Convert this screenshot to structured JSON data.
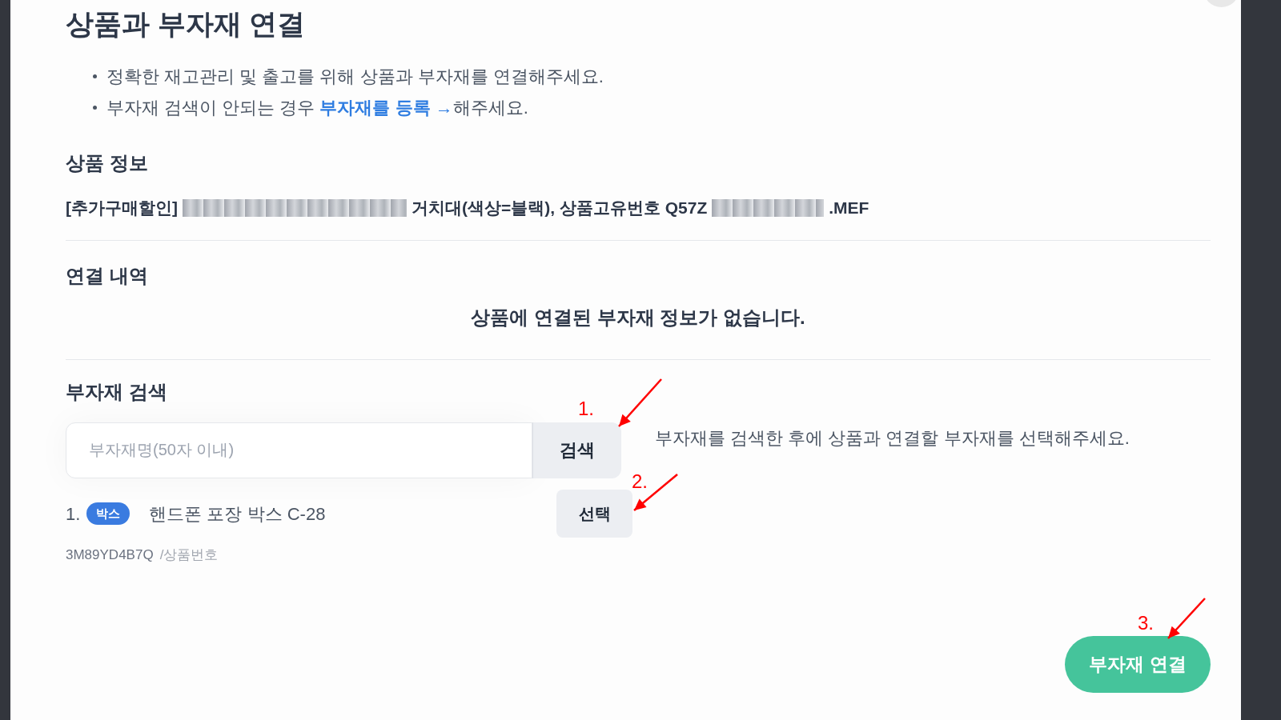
{
  "modal": {
    "title": "상품과 부자재 연결",
    "notes": [
      {
        "text": "정확한 재고관리 및 출고를 위해 상품과 부자재를 연결해주세요."
      },
      {
        "text": "부자재 검색이 안되는 경우 ",
        "link": "부자재를 등록 →",
        "after": "해주세요."
      }
    ],
    "product_info": {
      "heading": "상품 정보",
      "segments": [
        {
          "kind": "text",
          "text": "[추가구매할인]"
        },
        {
          "kind": "redacted"
        },
        {
          "kind": "text",
          "text": "거치대(색상=블랙), 상품고유번호 Q57Z"
        },
        {
          "kind": "redacted"
        },
        {
          "kind": "text",
          "text": ".MEF"
        }
      ]
    },
    "links": {
      "heading": "연결 내역",
      "empty_message": "상품에 연결된 부자재 정보가 없습니다."
    },
    "search": {
      "heading": "부자재 검색",
      "placeholder": "부자재명(50자 이내)",
      "button": "검색",
      "hint": "부자재를 검색한 후에 상품과 연결할 부자재를 선택해주세요.",
      "results": [
        {
          "index": "1.",
          "tag": "박스",
          "name": "핸드폰 포장 박스 C-28",
          "code": "3M89YD4B7Q",
          "code_label": "/상품번호",
          "button": "선택"
        }
      ]
    },
    "submit_button": "부자재 연결"
  },
  "annotations": [
    "1.",
    "2.",
    "3."
  ]
}
